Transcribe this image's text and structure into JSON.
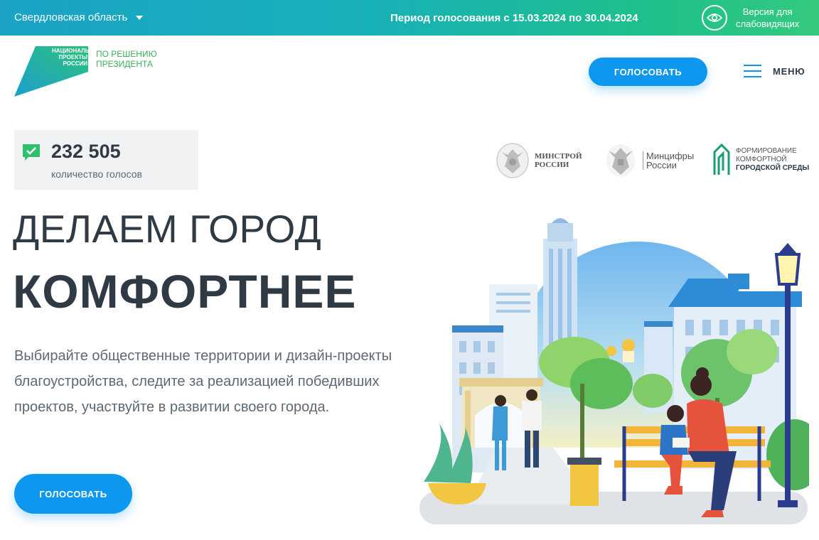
{
  "topbar": {
    "region": "Свердловская область",
    "period": "Период голосования с 15.03.2024 по 30.04.2024",
    "vision_line1": "Версия для",
    "vision_line2": "слабовидящих"
  },
  "header": {
    "logo_np_line1": "НАЦИОНАЛЬНЫЕ",
    "logo_np_line2": "ПРОЕКТЫ",
    "logo_np_line3": "РОССИИ",
    "logo_pres_line1": "ПО РЕШЕНИЮ",
    "logo_pres_line2": "ПРЕЗИДЕНТА",
    "vote_button": "ГОЛОСОВАТЬ",
    "menu_label": "МЕНЮ"
  },
  "counter": {
    "value": "232 505",
    "caption": "количество голосов"
  },
  "partners": {
    "minstroy_line1": "МИНСТРОЙ",
    "minstroy_line2": "РОССИИ",
    "mincifry_line1": "Минцифры",
    "mincifry_line2": "России",
    "fks_line1": "ФОРМИРОВАНИЕ",
    "fks_line2": "КОМФОРТНОЙ",
    "fks_line3": "ГОРОДСКОЙ СРЕДЫ"
  },
  "hero": {
    "title_line1": "ДЕЛАЕМ ГОРОД",
    "title_line2": "КОМФОРТНЕЕ",
    "description": "Выбирайте общественные территории и дизайн-проекты благоустройства, следите за реализацией победивших проектов, участвуйте в развитии своего города.",
    "vote_button": "ГОЛОСОВАТЬ"
  },
  "colors": {
    "accent": "#0d97ef",
    "brand_green": "#3fae5e",
    "text_dark": "#2f3a45"
  }
}
